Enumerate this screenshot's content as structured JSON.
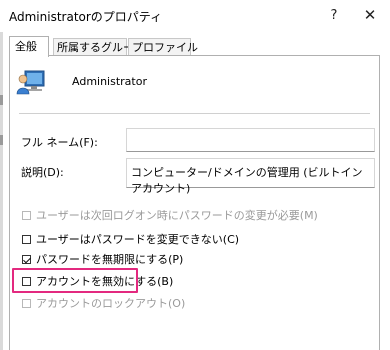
{
  "window": {
    "title": "Administratorのプロパティ",
    "help_label": "?",
    "close_label": "✕"
  },
  "tabs": [
    {
      "label": "全般",
      "active": true
    },
    {
      "label": "所属するグループ",
      "active": false
    },
    {
      "label": "プロファイル",
      "active": false
    }
  ],
  "user": {
    "name": "Administrator",
    "icon": "user-computer-icon"
  },
  "fields": {
    "full_name_label": "フル ネーム(F):",
    "full_name_value": "",
    "description_label": "説明(D):",
    "description_value": "コンピューター/ドメインの管理用 (ビルトイン アカウント)"
  },
  "options": [
    {
      "label": "ユーザーは次回ログオン時にパスワードの変更が必要(M)",
      "checked": false,
      "enabled": false
    },
    {
      "label": "ユーザーはパスワードを変更できない(C)",
      "checked": false,
      "enabled": true
    },
    {
      "label": "パスワードを無期限にする(P)",
      "checked": true,
      "enabled": true
    },
    {
      "label": "アカウントを無効にする(B)",
      "checked": false,
      "enabled": true
    },
    {
      "label": "アカウントのロックアウト(O)",
      "checked": false,
      "enabled": false
    }
  ],
  "colors": {
    "highlight": "#e3297f"
  }
}
